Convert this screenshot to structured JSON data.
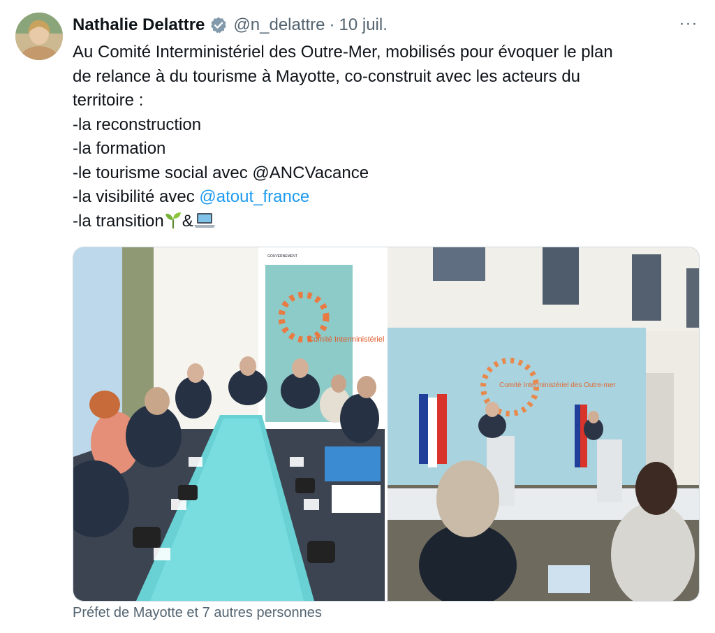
{
  "tweet": {
    "author_name": "Nathalie Delattre",
    "handle": "@n_delattre",
    "separator": "·",
    "date": "10 juil.",
    "more_label": "···",
    "lines": [
      "Au Comité Interministériel des Outre-Mer, mobilisés pour évoquer le plan",
      "de relance à du tourisme à Mayotte, co-construit avec les acteurs du",
      "territoire :",
      "-la reconstruction",
      "-la formation",
      "-le tourisme social avec @ANCVacance"
    ],
    "line7_prefix": "-la visibilité avec ",
    "line7_link": "@atout_france",
    "line8_prefix": "-la transition",
    "line8_amp": "&",
    "line8_icons": [
      "seedling-emoji",
      "laptop-emoji"
    ],
    "tagged_people": "Préfet de Mayotte et 7 autres personnes"
  },
  "media": {
    "photo1_banner_title": "Comité Interministériel des Outre-mer",
    "photo1_banner_header": "GOUVERNEMENT",
    "photo2_banner_title": "Comité Interministériel des Outre-mer"
  },
  "colors": {
    "link": "#1d9bf0",
    "secondary_text": "#536471",
    "verified_badge": "#829aab"
  }
}
